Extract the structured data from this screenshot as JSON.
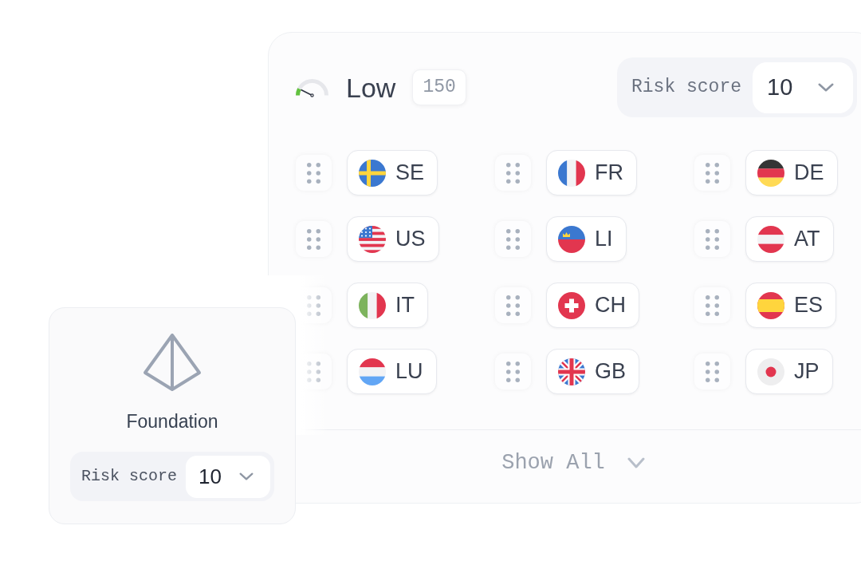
{
  "header": {
    "gauge": {
      "level": 0.15
    },
    "rating": "Low",
    "score": "150",
    "risk_score": {
      "label": "Risk score",
      "value": "10"
    }
  },
  "countries": [
    {
      "code": "SE",
      "kind": "sweden"
    },
    {
      "code": "FR",
      "kind": "france"
    },
    {
      "code": "DE",
      "kind": "germany"
    },
    {
      "code": "US",
      "kind": "usa"
    },
    {
      "code": "LI",
      "kind": "liechtenstein"
    },
    {
      "code": "AT",
      "kind": "austria"
    },
    {
      "code": "IT",
      "kind": "italy"
    },
    {
      "code": "CH",
      "kind": "switzerland"
    },
    {
      "code": "ES",
      "kind": "spain"
    },
    {
      "code": "LU",
      "kind": "luxembourg"
    },
    {
      "code": "GB",
      "kind": "britain"
    },
    {
      "code": "JP",
      "kind": "japan"
    }
  ],
  "show_all": "Show All",
  "foundation_card": {
    "title": "Foundation",
    "risk_score": {
      "label": "Risk score",
      "value": "10"
    }
  }
}
